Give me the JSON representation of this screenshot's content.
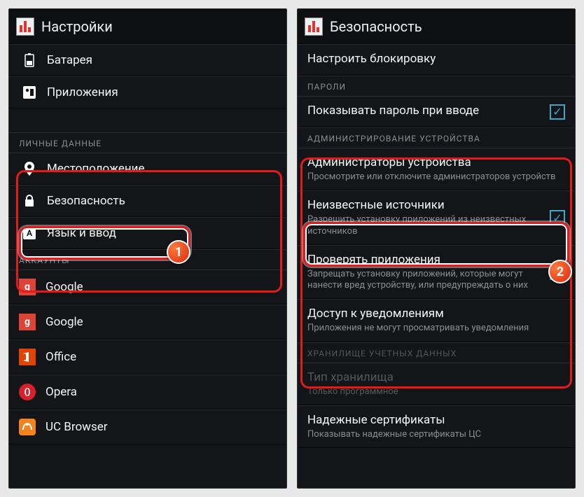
{
  "left": {
    "header": {
      "title": "Настройки"
    },
    "battery": "Батарея",
    "apps": "Приложения",
    "sect_personal": "ЛИЧНЫЕ ДАННЫЕ",
    "location": "Местоположение",
    "security": "Безопасность",
    "language": "Язык и ввод",
    "sect_accounts": "АККАУНТЫ",
    "google1": "Google",
    "google2": "Google",
    "office": "Office",
    "opera": "Opera",
    "uc": "UC Browser"
  },
  "right": {
    "header": {
      "title": "Безопасность"
    },
    "lock_setup": "Настроить блокировку",
    "sect_passwords": "ПАРОЛИ",
    "show_pass": "Показывать пароль при вводе",
    "sect_admin": "АДМИНИСТРИРОВАНИЕ УСТРОЙСТВА",
    "admins": {
      "title": "Администраторы устройства",
      "sub": "Просмотрите или отключите администраторов устройств"
    },
    "unknown": {
      "title": "Неизвестные источники",
      "sub": "Разрешить установку приложений из неизвестных источников"
    },
    "verify": {
      "title": "Проверять приложения",
      "sub": "Запрещать установку приложений, которые могут нанести вред устройству, или предупреждать о них"
    },
    "notif": {
      "title": "Доступ к уведомлениям",
      "sub": "Приложения не могут просматривать уведомления"
    },
    "sect_storage": "ХРАНИЛИЩЕ УЧЕТНЫХ ДАННЫХ",
    "stype": {
      "title": "Тип хранилища",
      "sub": "Только программное"
    },
    "certs": {
      "title": "Надежные сертификаты",
      "sub": "Показывать надежные сертификаты ЦС"
    }
  },
  "badge1": "1",
  "badge2": "2"
}
